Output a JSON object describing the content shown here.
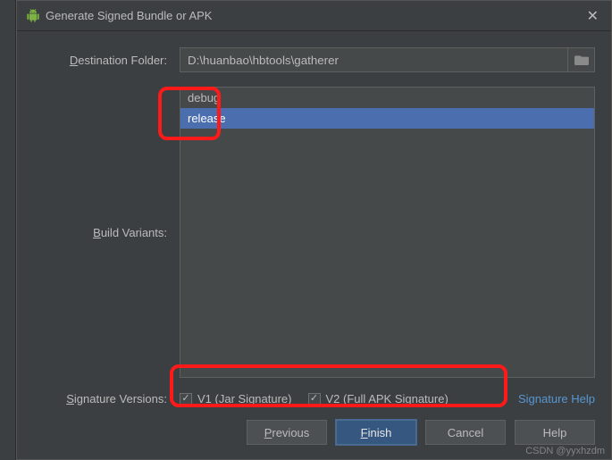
{
  "titlebar": {
    "title": "Generate Signed Bundle or APK"
  },
  "labels": {
    "destination_pre": "D",
    "destination_post": "estination Folder:",
    "build_variants_pre": "B",
    "build_variants_post": "uild Variants:",
    "sig_versions_pre": "S",
    "sig_versions_post": "ignature Versions:"
  },
  "destination": {
    "value": "D:\\huanbao\\hbtools\\gatherer"
  },
  "variants": [
    {
      "name": "debug",
      "selected": false
    },
    {
      "name": "release",
      "selected": true
    }
  ],
  "signature": {
    "v1_pre": "V1 (",
    "v1_mn": "J",
    "v1_post": "ar Signature)",
    "v1_checked": true,
    "v2_pre": "V2 (Full ",
    "v2_mn": "A",
    "v2_post": "PK Signature)",
    "v2_checked": true,
    "help_link": "Signature Help"
  },
  "buttons": {
    "previous_mn": "P",
    "previous_post": "revious",
    "finish_mn": "F",
    "finish_post": "inish",
    "cancel": "Cancel",
    "help": "Help"
  },
  "watermark": "CSDN @yyxhzdm"
}
